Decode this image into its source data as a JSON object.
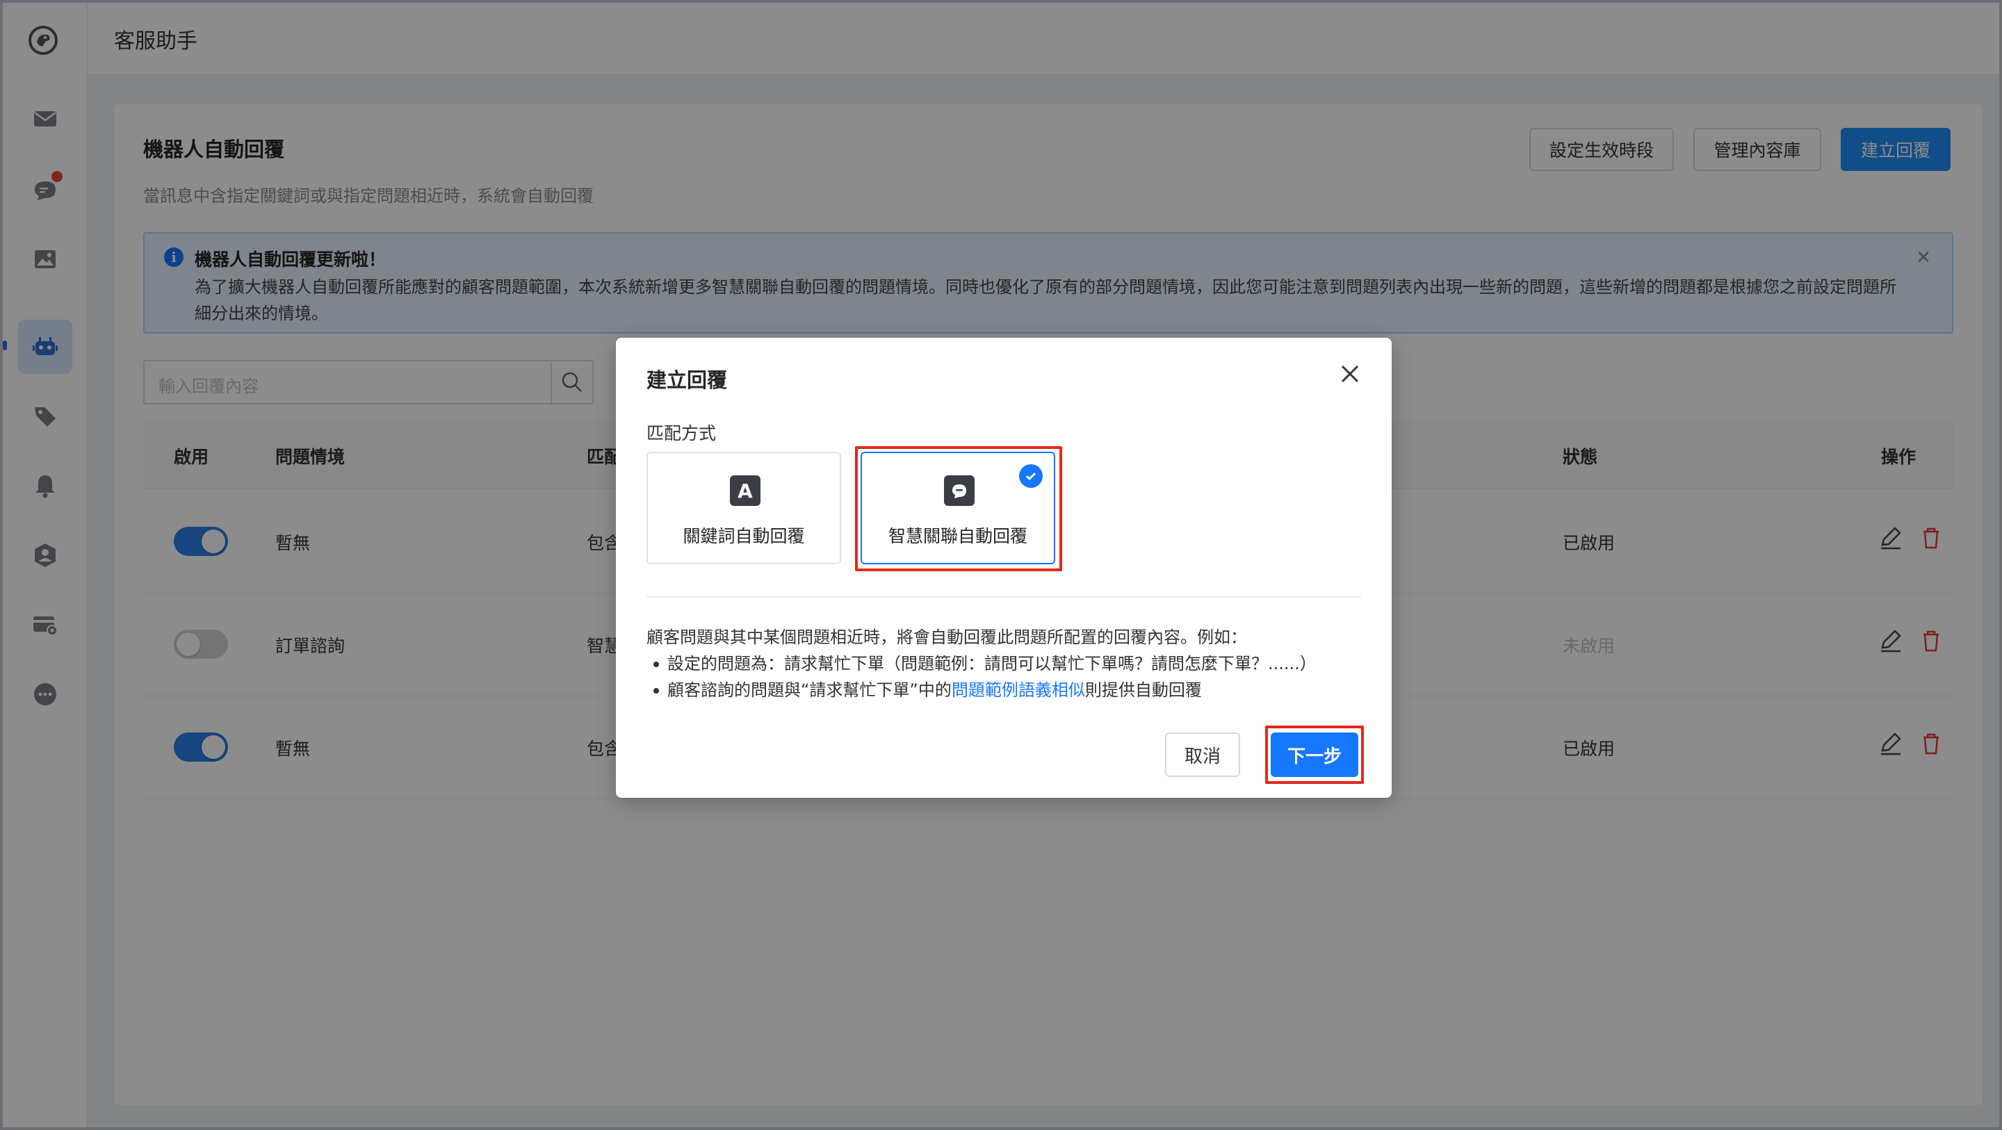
{
  "header": {
    "app_title": "客服助手"
  },
  "sidebar": {
    "items": [
      {
        "icon": "mail-icon"
      },
      {
        "icon": "chat-icon",
        "has_badge": true
      },
      {
        "icon": "image-icon"
      },
      {
        "icon": "robot-icon",
        "active": true
      },
      {
        "icon": "tag-icon"
      },
      {
        "icon": "bell-icon"
      },
      {
        "icon": "user-group-icon"
      },
      {
        "icon": "card-settings-icon"
      },
      {
        "icon": "more-icon"
      }
    ]
  },
  "page": {
    "title": "機器人自動回覆",
    "description": "當訊息中含指定關鍵詞或與指定問題相近時，系統會自動回覆",
    "buttons": {
      "schedule": "設定生效時段",
      "library": "管理內容庫",
      "create": "建立回覆"
    }
  },
  "notice": {
    "title": "機器人自動回覆更新啦！",
    "body": "為了擴大機器人自動回覆所能應對的顧客問題範圍，本次系統新增更多智慧關聯自動回覆的問題情境。同時也優化了原有的部分問題情境，因此您可能注意到問題列表內出現一些新的問題，這些新增的問題都是根據您之前設定問題所細分出來的情境。"
  },
  "search": {
    "placeholder": "輸入回覆內容"
  },
  "table": {
    "headers": {
      "enabled": "啟用",
      "scenario": "問題情境",
      "match": "匹配",
      "status": "狀態",
      "actions": "操作"
    },
    "rows": [
      {
        "enabled": true,
        "scenario": "暫無",
        "match": "包含",
        "status": "已啟用"
      },
      {
        "enabled": false,
        "scenario": "訂單諮詢",
        "match": "智慧",
        "status": "未啟用"
      },
      {
        "enabled": true,
        "scenario": "暫無",
        "match": "包含",
        "status": "已啟用"
      }
    ]
  },
  "modal": {
    "title": "建立回覆",
    "section_label": "匹配方式",
    "options": [
      {
        "label": "關鍵詞自動回覆",
        "icon_glyph": "A",
        "selected": false
      },
      {
        "label": "智慧關聯自動回覆",
        "icon_glyph": "",
        "selected": true
      }
    ],
    "explain_intro": "顧客問題與其中某個問題相近時，將會自動回覆此問題所配置的回覆內容。例如：",
    "explain_bullet1": "設定的問題為：請求幫忙下單（問題範例：請問可以幫忙下單嗎？請問怎麼下單？......）",
    "explain_bullet2_pre": "顧客諮詢的問題與“請求幫忙下單”中的",
    "explain_bullet2_link": "問題範例語義相似",
    "explain_bullet2_post": "則提供自動回覆",
    "cancel_label": "取消",
    "next_label": "下一步"
  },
  "colors": {
    "primary": "#1677ff",
    "highlight": "#e5281d",
    "toggle_on": "#2a7fe8"
  }
}
